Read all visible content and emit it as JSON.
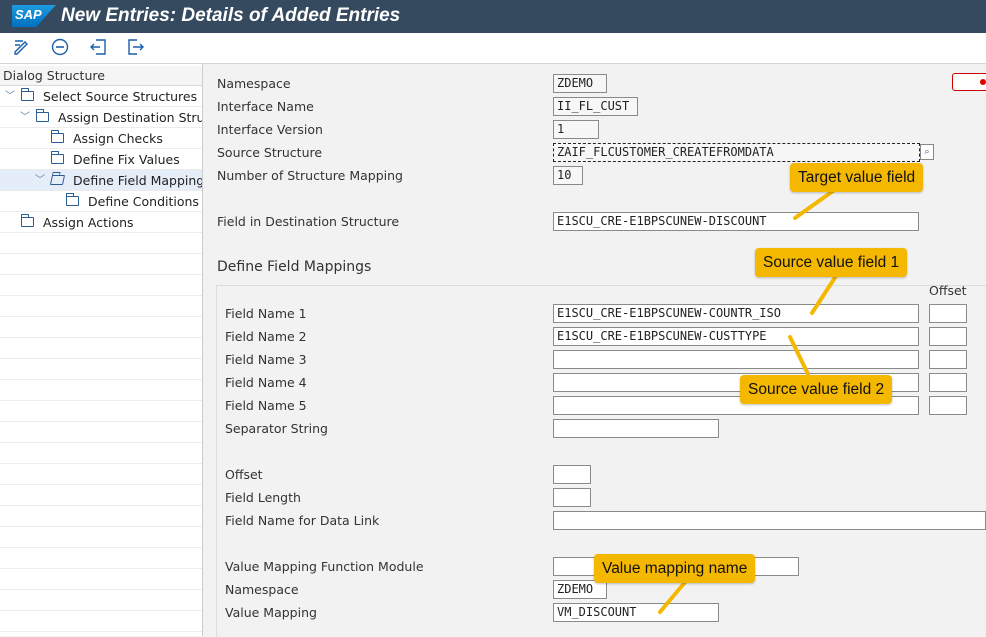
{
  "window": {
    "title": "New Entries: Details of Added Entries",
    "logo_text": "SAP"
  },
  "toolbar": {
    "icons": [
      "display-change-icon",
      "minus-circle-icon",
      "back-icon",
      "exit-icon"
    ]
  },
  "dialog_structure": {
    "header": "Dialog Structure",
    "items": [
      {
        "label": "Select Source Structures",
        "level": 0,
        "expanded": true,
        "selected": false
      },
      {
        "label": "Assign Destination Structu",
        "level": 1,
        "expanded": true,
        "selected": false
      },
      {
        "label": "Assign Checks",
        "level": 2,
        "expanded": false,
        "selected": false
      },
      {
        "label": "Define Fix Values",
        "level": 2,
        "expanded": false,
        "selected": false
      },
      {
        "label": "Define Field Mappings",
        "level": 2,
        "expanded": true,
        "selected": true
      },
      {
        "label": "Define Conditions",
        "level": 3,
        "expanded": false,
        "selected": false
      },
      {
        "label": "Assign Actions",
        "level": 0,
        "expanded": false,
        "selected": false
      }
    ]
  },
  "header_fields": {
    "namespace": {
      "label": "Namespace",
      "value": "ZDEMO"
    },
    "interface_name": {
      "label": "Interface Name",
      "value": "II_FL_CUST"
    },
    "interface_version": {
      "label": "Interface Version",
      "value": "1"
    },
    "source_structure": {
      "label": "Source Structure",
      "value": "ZAIF_FLCUSTOMER_CREATEFROMDATA"
    },
    "structure_mapping": {
      "label": "Number of Structure Mapping",
      "value": "10"
    },
    "destination_field": {
      "label": "Field in Destination Structure",
      "value": "E1SCU_CRE-E1BPSCUNEW-DISCOUNT"
    }
  },
  "field_mappings": {
    "section_title": "Define Field Mappings",
    "offset_header": "Offset",
    "fields": [
      {
        "label": "Field Name 1",
        "value": "E1SCU_CRE-E1BPSCUNEW-COUNTR_ISO"
      },
      {
        "label": "Field Name 2",
        "value": "E1SCU_CRE-E1BPSCUNEW-CUSTTYPE"
      },
      {
        "label": "Field Name 3",
        "value": ""
      },
      {
        "label": "Field Name 4",
        "value": ""
      },
      {
        "label": "Field Name 5",
        "value": ""
      }
    ],
    "separator_string": {
      "label": "Separator String",
      "value": ""
    },
    "offset": {
      "label": "Offset",
      "value": ""
    },
    "field_length": {
      "label": "Field Length",
      "value": ""
    },
    "data_link": {
      "label": "Field Name for Data Link",
      "value": ""
    },
    "value_mapping_fm": {
      "label": "Value Mapping Function Module",
      "value": ""
    },
    "vm_namespace": {
      "label": "Namespace",
      "value": "ZDEMO"
    },
    "value_mapping": {
      "label": "Value Mapping",
      "value": "VM_DISCOUNT"
    }
  },
  "callouts": {
    "target": "Target value field",
    "source1": "Source value field 1",
    "source2": "Source value field 2",
    "vm_name": "Value mapping name"
  },
  "colors": {
    "title_bar": "#354a5f",
    "callout": "#f5b800",
    "selection": "#e5edf8"
  }
}
